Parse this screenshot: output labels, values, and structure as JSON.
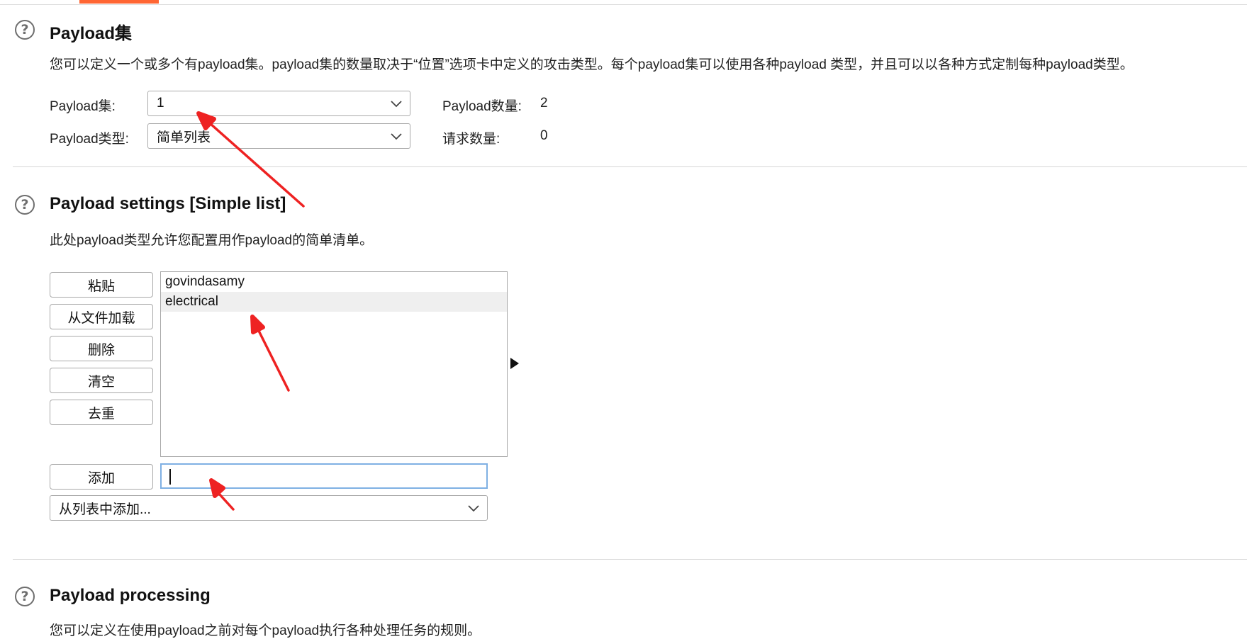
{
  "section1": {
    "title": "Payload集",
    "description": "您可以定义一个或多个有payload集。payload集的数量取决于“位置”选项卡中定义的攻击类型。每个payload集可以使用各种payload 类型，并且可以以各种方式定制每种payload类型。",
    "set_label": "Payload集:",
    "set_value": "1",
    "type_label": "Payload类型:",
    "type_value": "简单列表",
    "count_label": "Payload数量:",
    "count_value": "2",
    "requests_label": "请求数量:",
    "requests_value": "0"
  },
  "section2": {
    "title": "Payload settings [Simple list]",
    "description": "此处payload类型允许您配置用作payload的简单清单。",
    "buttons": {
      "paste": "粘贴",
      "load": "从文件加载",
      "remove": "删除",
      "clear": "清空",
      "dedupe": "去重",
      "add": "添加"
    },
    "list_items": [
      "govindasamy",
      "electrical"
    ],
    "selected_index": 1,
    "add_input_value": "",
    "add_from_list": "从列表中添加..."
  },
  "section3": {
    "title": "Payload processing",
    "description": "您可以定义在使用payload之前对每个payload执行各种处理任务的规则。"
  },
  "icons": {
    "help": "help-circle-icon",
    "dropdown": "chevron-down-icon",
    "expand": "triangle-right-icon",
    "annotation": "red-arrow"
  },
  "colors": {
    "tab_accent": "#ff6633",
    "annotation": "#ee2222",
    "input_focus": "#7fb0e3"
  }
}
